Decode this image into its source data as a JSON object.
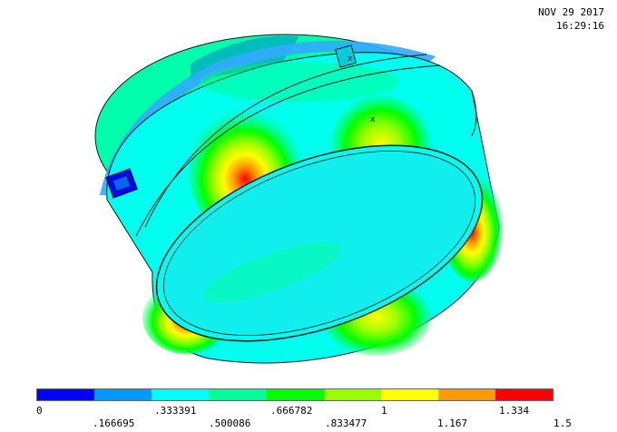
{
  "stamp": {
    "date": "NOV 29 2017",
    "time": "16:29:16"
  },
  "model": {
    "markers": [
      "x",
      "x"
    ],
    "colors": {
      "outline": "#1a1a1a",
      "base": "#00ffff",
      "band_green": "#00ff66"
    }
  },
  "legend": {
    "colors": [
      "#0000ff",
      "#0099ff",
      "#00ffff",
      "#00ff99",
      "#00ff00",
      "#99ff00",
      "#ffff00",
      "#ff9900",
      "#ff0000"
    ],
    "labels_top": [
      "0",
      ".333391",
      ".666782",
      "1",
      "1.334"
    ],
    "labels_bottom": [
      ".166695",
      ".500086",
      ".833477",
      "1.167",
      "1.5"
    ]
  }
}
